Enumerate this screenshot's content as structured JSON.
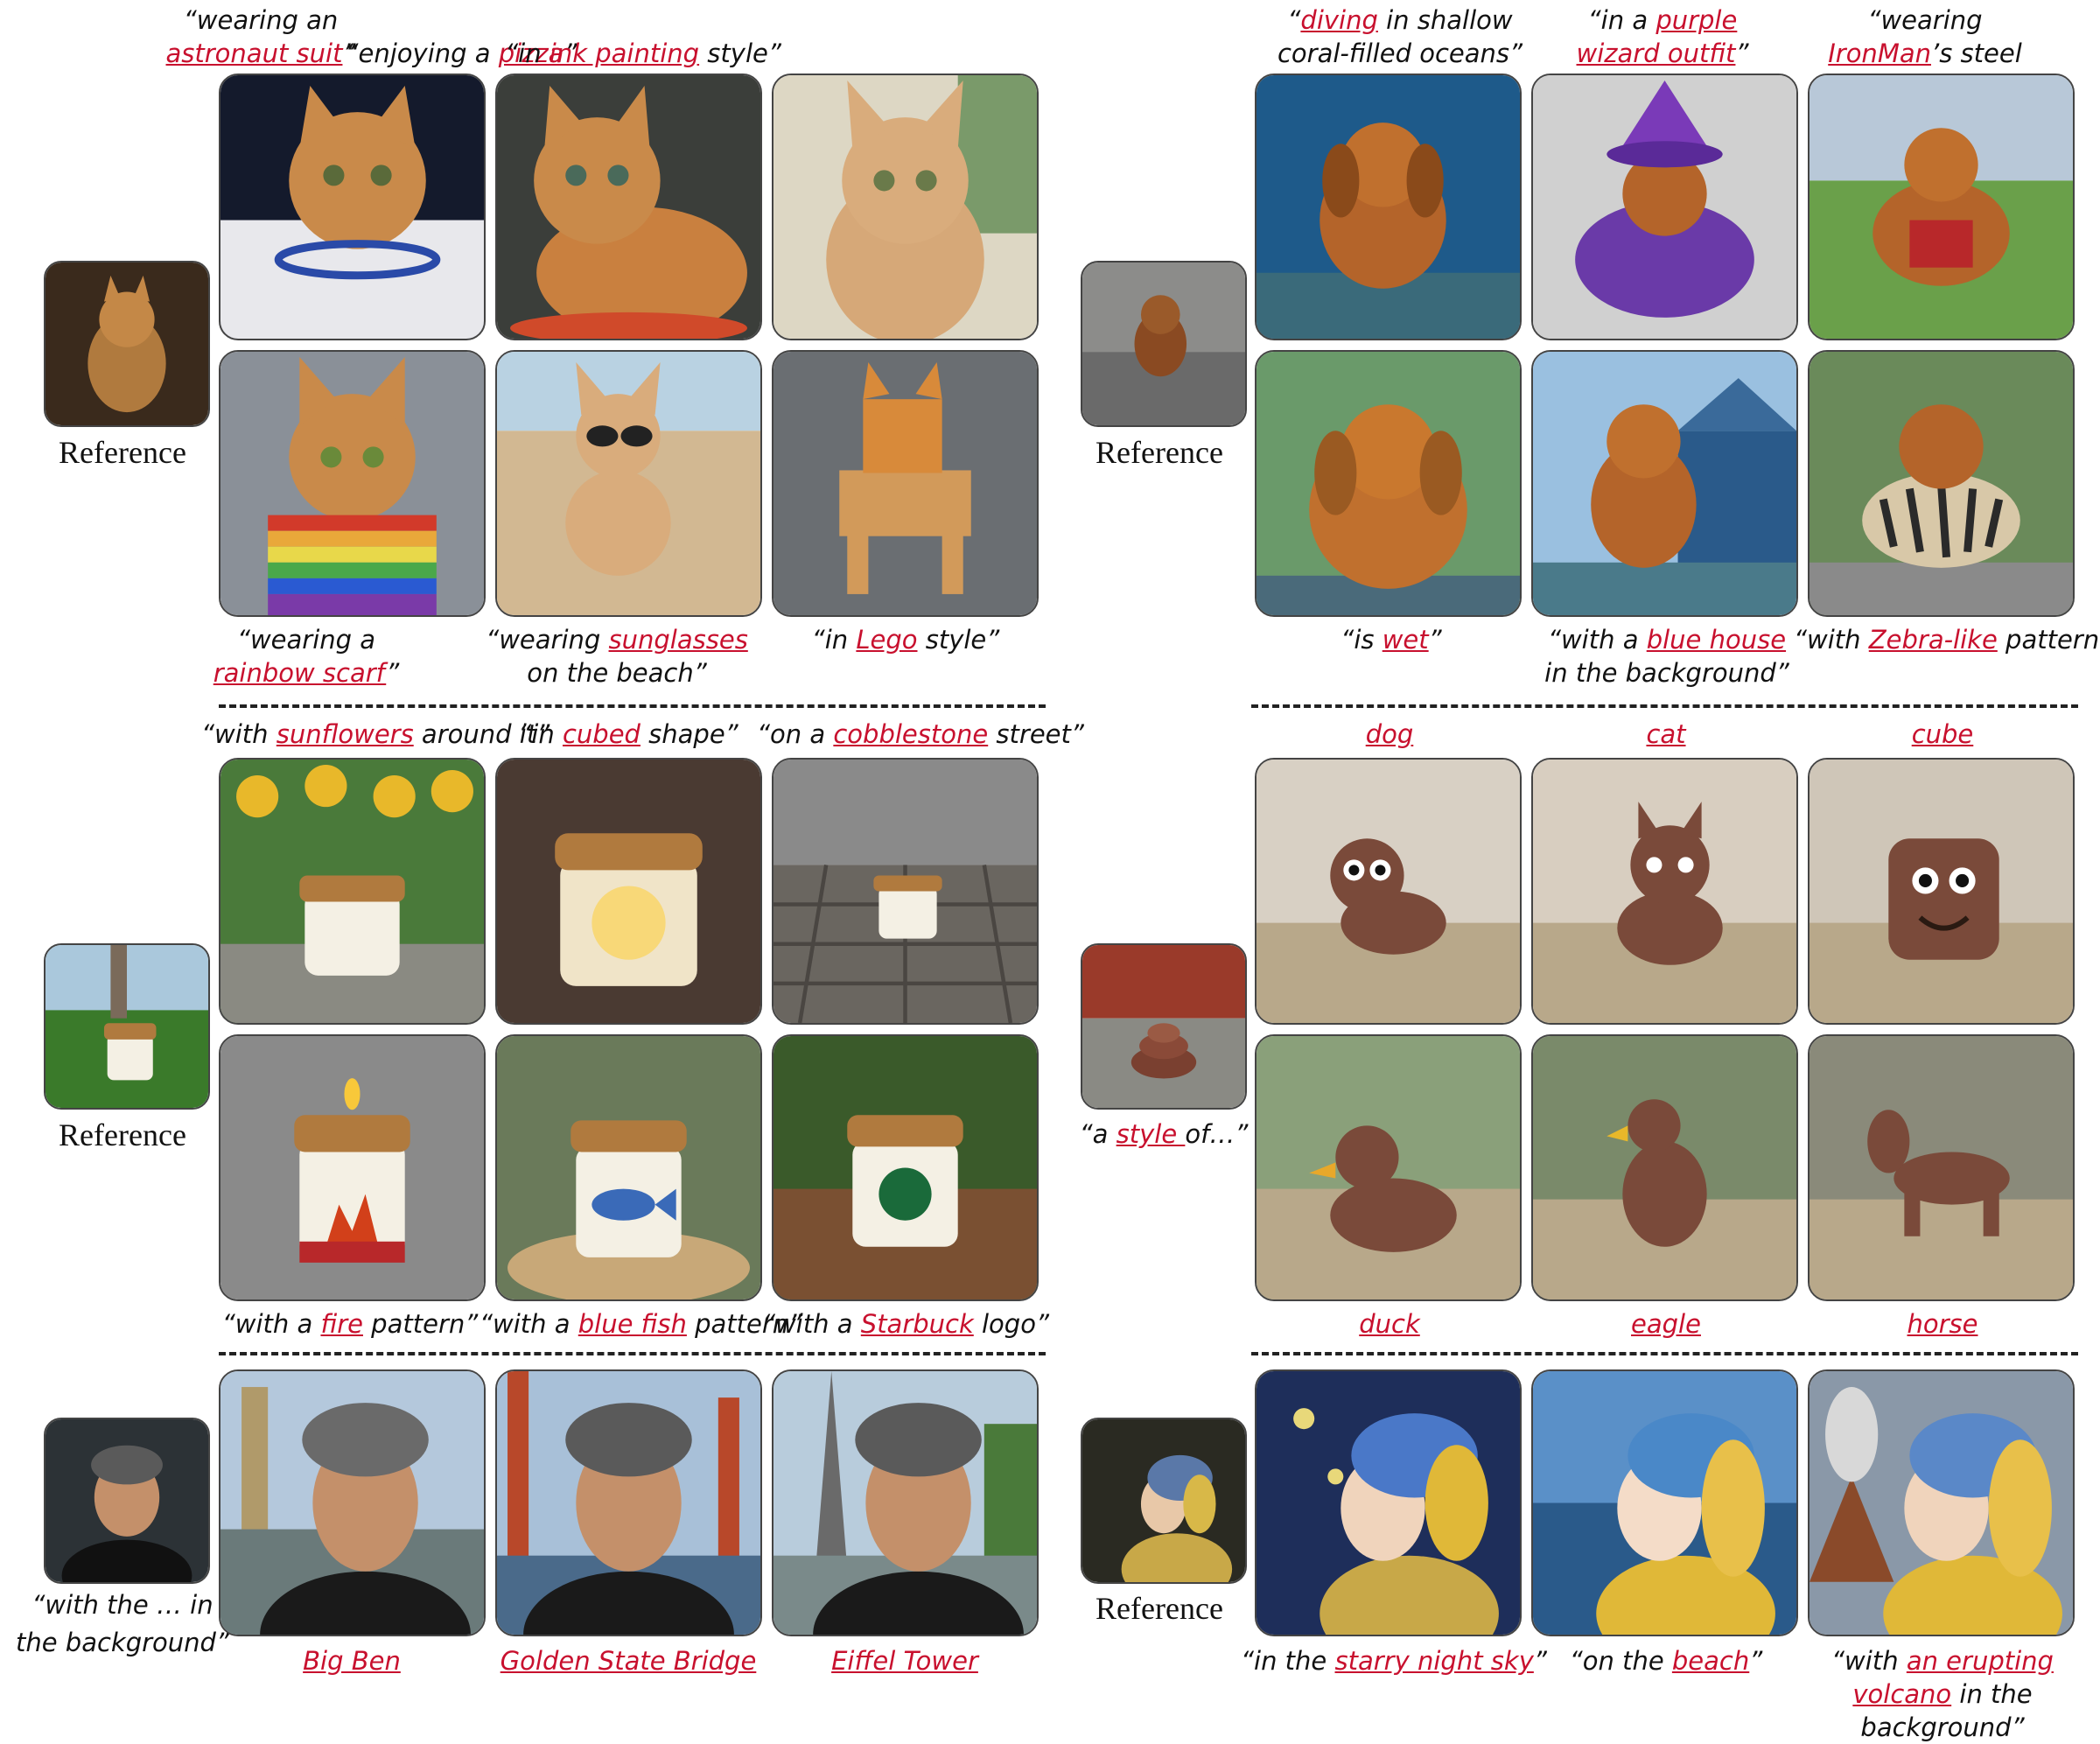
{
  "panels": {
    "cat": {
      "reference_label": "Reference",
      "top_captions": [
        {
          "pre": "“wearing an ",
          "hl": "astronaut suit",
          "post": "”"
        },
        {
          "pre": "“enjoying a ",
          "hl": "pizza",
          "post": "”"
        },
        {
          "pre": "“in ",
          "hl": "ink painting",
          "post": " style”"
        }
      ],
      "bottom_captions": [
        {
          "pre": "“wearing a ",
          "hl": "rainbow scarf",
          "post": "”"
        },
        {
          "pre": "“wearing ",
          "hl": "sunglasses",
          "post": " on the beach”"
        },
        {
          "pre": "“in ",
          "hl": "Lego",
          "post": " style”"
        }
      ]
    },
    "dog": {
      "reference_label": "Reference",
      "top_captions": [
        {
          "pre": "“",
          "hl": "diving",
          "post": " in shallow coral-filled oceans”"
        },
        {
          "pre": "“in a ",
          "hl": "purple wizard outfit",
          "post": "”"
        },
        {
          "pre": "“wearing ",
          "hl": "IronMan",
          "post": "’s steel armor”"
        }
      ],
      "bottom_captions": [
        {
          "pre": "“is ",
          "hl": "wet",
          "post": "”"
        },
        {
          "pre": "“with a ",
          "hl": "blue house",
          "post": " in the background”"
        },
        {
          "pre": "“with ",
          "hl": "Zebra-like",
          "post": " pattern”"
        }
      ]
    },
    "candle": {
      "reference_label": "Reference",
      "top_captions": [
        {
          "pre": "“with ",
          "hl": "sunflowers",
          "post": " around it”"
        },
        {
          "pre": "“in ",
          "hl": "cubed",
          "post": " shape”"
        },
        {
          "pre": "“on a ",
          "hl": "cobblestone",
          "post": " street”"
        }
      ],
      "bottom_captions": [
        {
          "pre": "“with a ",
          "hl": "fire",
          "post": " pattern”"
        },
        {
          "pre": "“with a ",
          "hl": "blue fish",
          "post": " pattern”"
        },
        {
          "pre": "“with a ",
          "hl": "Starbuck",
          "post": " logo”"
        }
      ]
    },
    "poop": {
      "reference_caption": {
        "pre": "“a ",
        "hl": "style ",
        "post": "of…”"
      },
      "top_captions": [
        {
          "pre": "",
          "hl": "dog",
          "post": ""
        },
        {
          "pre": "",
          "hl": "cat",
          "post": ""
        },
        {
          "pre": "",
          "hl": "cube",
          "post": ""
        }
      ],
      "bottom_captions": [
        {
          "pre": "",
          "hl": "duck",
          "post": ""
        },
        {
          "pre": "",
          "hl": "eagle",
          "post": ""
        },
        {
          "pre": "",
          "hl": "horse",
          "post": ""
        }
      ]
    },
    "man": {
      "reference_caption_line1": "“with the … in",
      "reference_caption_line2": "the background”",
      "bottom_captions": [
        {
          "pre": "",
          "hl": "Big Ben",
          "post": ""
        },
        {
          "pre": "",
          "hl": "Golden State Bridge",
          "post": ""
        },
        {
          "pre": "",
          "hl": "Eiffel Tower",
          "post": ""
        }
      ]
    },
    "girl": {
      "reference_label": "Reference",
      "bottom_captions": [
        {
          "pre": "“in the ",
          "hl": "starry night sky",
          "post": "”"
        },
        {
          "pre": "“on the ",
          "hl": "beach",
          "post": "”"
        },
        {
          "pre": "“with ",
          "hl": "an erupting volcano",
          "post": " in the background”"
        }
      ]
    }
  },
  "colors": {
    "highlight": "#c8102e",
    "border": "#444444",
    "dash": "#222222"
  }
}
